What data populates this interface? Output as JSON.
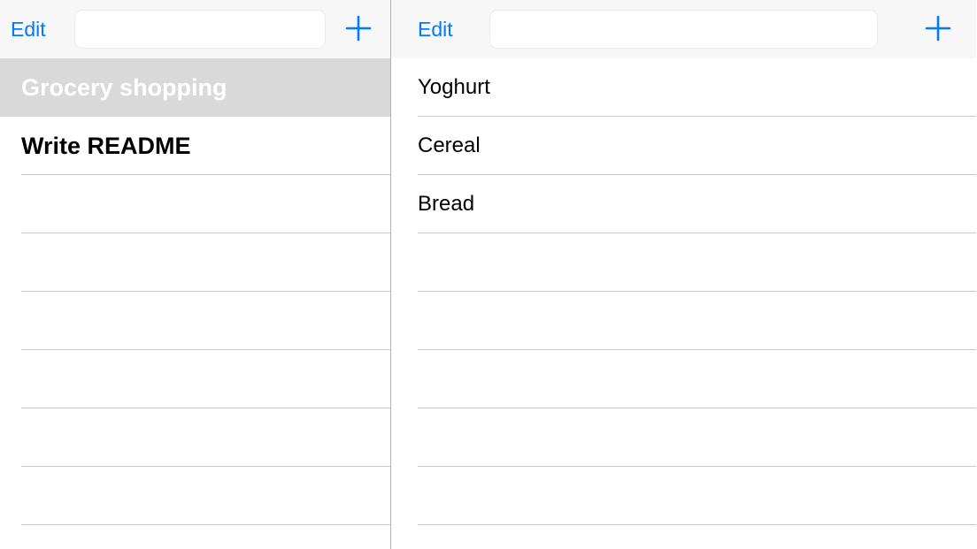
{
  "accent_color": "#007aff",
  "master": {
    "edit_label": "Edit",
    "search": {
      "value": "",
      "placeholder": ""
    },
    "add_icon": "plus-icon",
    "items": [
      {
        "label": "Grocery shopping",
        "selected": true
      },
      {
        "label": "Write README",
        "selected": false
      },
      {
        "label": ""
      },
      {
        "label": ""
      },
      {
        "label": ""
      },
      {
        "label": ""
      },
      {
        "label": ""
      },
      {
        "label": ""
      },
      {
        "label": ""
      }
    ]
  },
  "detail": {
    "edit_label": "Edit",
    "search": {
      "value": "",
      "placeholder": ""
    },
    "add_icon": "plus-icon",
    "items": [
      {
        "label": "Yoghurt"
      },
      {
        "label": "Cereal"
      },
      {
        "label": "Bread"
      },
      {
        "label": ""
      },
      {
        "label": ""
      },
      {
        "label": ""
      },
      {
        "label": ""
      },
      {
        "label": ""
      },
      {
        "label": ""
      }
    ]
  }
}
